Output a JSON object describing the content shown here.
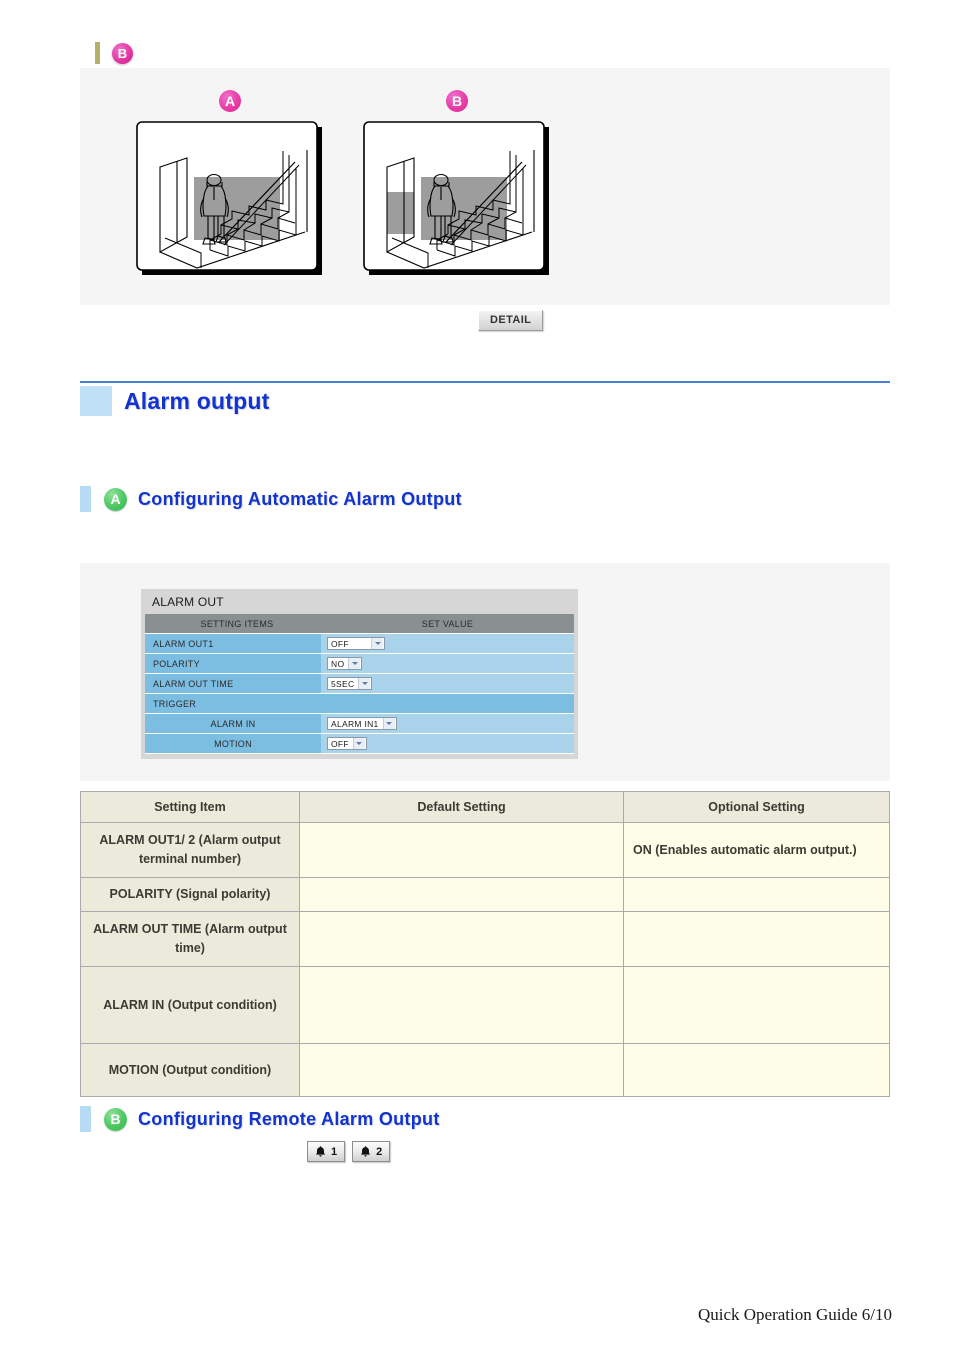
{
  "top_marker": {
    "badge": "B",
    "bar_color": "#b5b06a",
    "badge_color": "#e0359f"
  },
  "illustrations": {
    "items": [
      {
        "label": "A",
        "caption": "camera view with detection area over stairs"
      },
      {
        "label": "B",
        "caption": "camera view with detection area over stairs and wall panel"
      }
    ]
  },
  "detail_button": {
    "label": "DETAIL"
  },
  "section": {
    "title": "Alarm output",
    "accent_color": "#1433cc",
    "rule_color": "#4a7fd4",
    "chip_color": "#bfe0f5"
  },
  "subsection_a": {
    "badge": "A",
    "title": "Configuring Automatic Alarm Output"
  },
  "settings_panel": {
    "caption": "ALARM OUT",
    "header": {
      "item_col": "SETTING ITEMS",
      "value_col": "SET VALUE"
    },
    "rows": [
      {
        "label": "ALARM OUT1",
        "value": "OFF",
        "type": "select",
        "indent": false
      },
      {
        "label": "POLARITY",
        "value": "NO",
        "type": "select",
        "indent": false
      },
      {
        "label": "ALARM OUT TIME",
        "value": "5SEC",
        "type": "select",
        "indent": false
      },
      {
        "label": "TRIGGER",
        "value": "",
        "type": "group",
        "indent": false
      },
      {
        "label": "ALARM IN",
        "value": "ALARM IN1",
        "type": "select",
        "indent": true
      },
      {
        "label": "MOTION",
        "value": "OFF",
        "type": "select",
        "indent": true
      }
    ],
    "header_bg": "#8a8f91",
    "label_bg": "#7cbde2",
    "value_bg": "#a8d3ea"
  },
  "desc_table": {
    "columns": [
      "Setting Item",
      "Default Setting",
      "Optional Setting"
    ],
    "rows": [
      {
        "item": "ALARM OUT1/ 2 (Alarm output terminal number)",
        "default": "",
        "optional": "ON (Enables automatic alarm output.)"
      },
      {
        "item": "POLARITY (Signal polarity)",
        "default": "",
        "optional": ""
      },
      {
        "item": "ALARM OUT TIME (Alarm output time)",
        "default": "",
        "optional": ""
      },
      {
        "item": "ALARM IN (Output condition)",
        "default": "",
        "optional": ""
      },
      {
        "item": "MOTION (Output condition)",
        "default": "",
        "optional": ""
      }
    ]
  },
  "subsection_b": {
    "badge": "B",
    "title": "Configuring Remote Alarm Output"
  },
  "alarm_buttons": [
    {
      "icon": "bell-icon",
      "label": "1"
    },
    {
      "icon": "bell-icon",
      "label": "2"
    }
  ],
  "footer": {
    "text": "Quick Operation Guide 6/10"
  }
}
